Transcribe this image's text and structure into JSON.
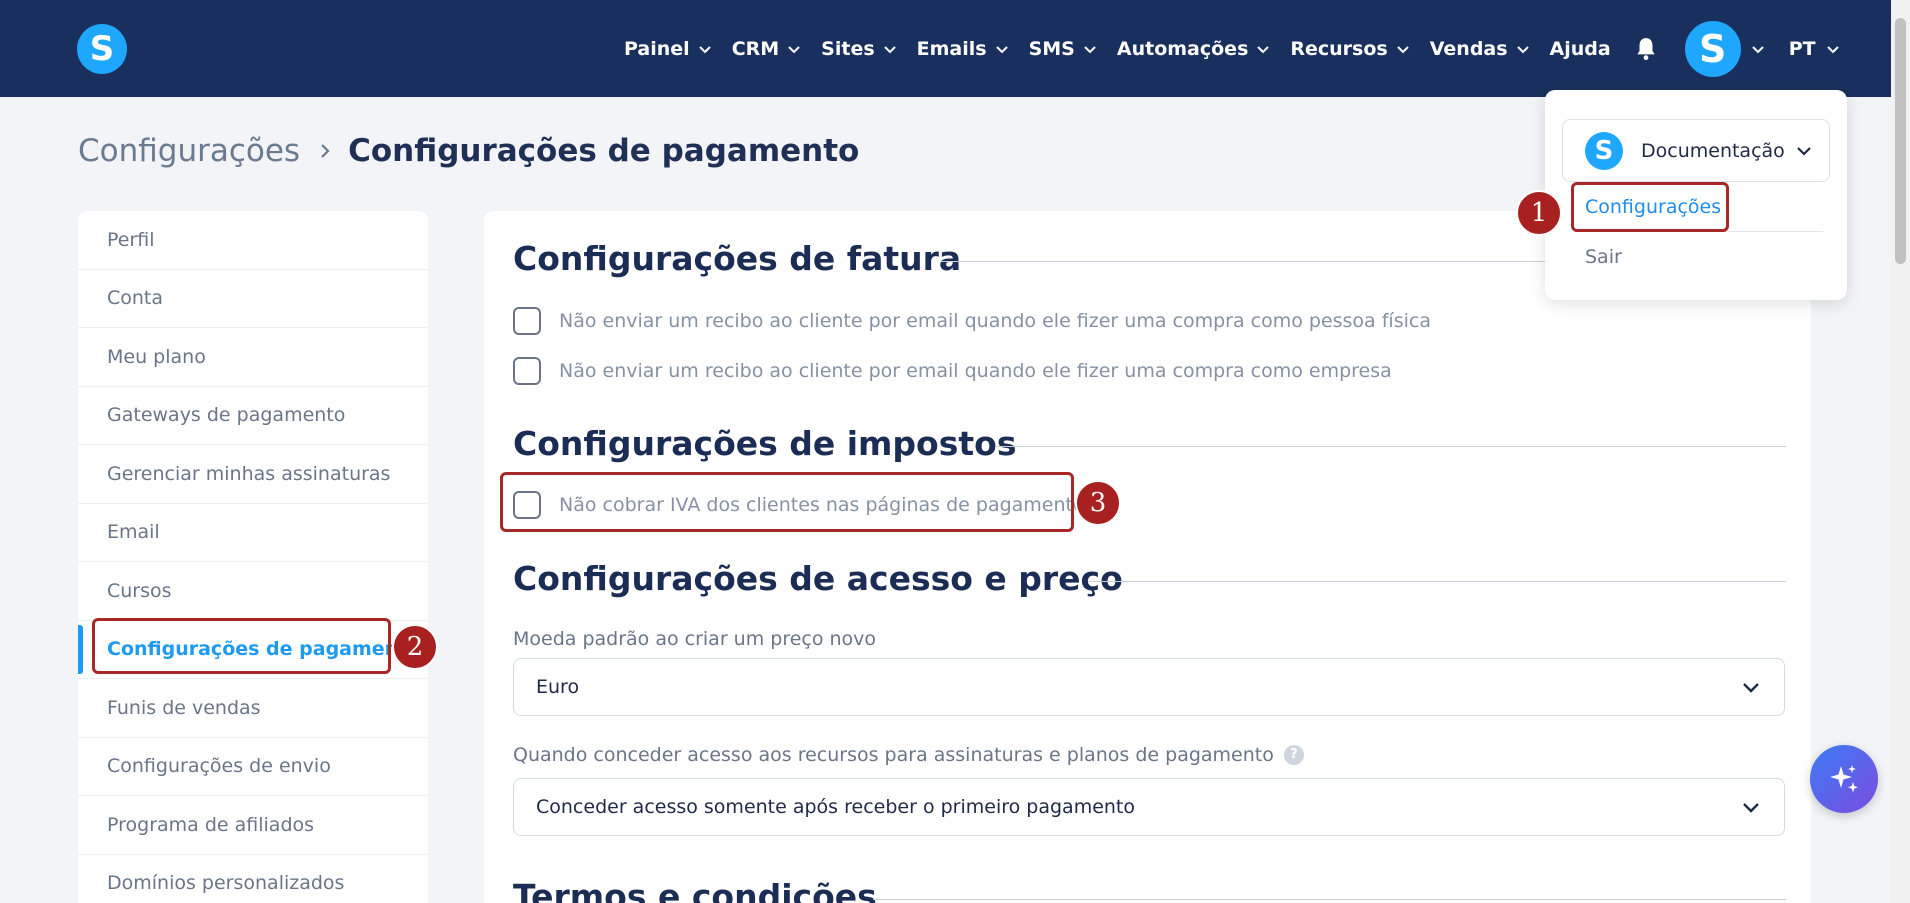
{
  "brand": {
    "logo_letter": "S"
  },
  "nav": {
    "items": [
      {
        "label": "Painel",
        "has_chevron": true
      },
      {
        "label": "CRM",
        "has_chevron": true
      },
      {
        "label": "Sites",
        "has_chevron": true
      },
      {
        "label": "Emails",
        "has_chevron": true
      },
      {
        "label": "SMS",
        "has_chevron": true
      },
      {
        "label": "Automações",
        "has_chevron": true
      },
      {
        "label": "Recursos",
        "has_chevron": true
      },
      {
        "label": "Vendas",
        "has_chevron": true
      },
      {
        "label": "Ajuda",
        "has_chevron": false
      }
    ],
    "avatar_letter": "S",
    "language": "PT"
  },
  "breadcrumb": {
    "root": "Configurações",
    "current": "Configurações de pagamento"
  },
  "sidebar": {
    "items": [
      {
        "label": "Perfil"
      },
      {
        "label": "Conta"
      },
      {
        "label": "Meu plano"
      },
      {
        "label": "Gateways de pagamento"
      },
      {
        "label": "Gerenciar minhas assinaturas"
      },
      {
        "label": "Email"
      },
      {
        "label": "Cursos"
      },
      {
        "label": "Configurações de pagamento"
      },
      {
        "label": "Funis de vendas"
      },
      {
        "label": "Configurações de envio"
      },
      {
        "label": "Programa de afiliados"
      },
      {
        "label": "Domínios personalizados"
      }
    ],
    "active_index": 7
  },
  "main": {
    "invoice": {
      "title": "Configurações de fatura",
      "options": [
        "Não enviar um recibo ao cliente por email quando ele fizer uma compra como pessoa física",
        "Não enviar um recibo ao cliente por email quando ele fizer uma compra como empresa"
      ]
    },
    "tax": {
      "title": "Configurações de impostos",
      "option": "Não cobrar IVA dos clientes nas páginas de pagamento"
    },
    "access": {
      "title": "Configurações de acesso e preço",
      "currency_label": "Moeda padrão ao criar um preço novo",
      "currency_value": "Euro",
      "access_label": "Quando conceder acesso aos recursos para assinaturas e planos de pagamento",
      "access_value": "Conceder acesso somente após receber o primeiro pagamento",
      "help_glyph": "?"
    },
    "terms": {
      "title": "Termos e condições"
    }
  },
  "dropdown": {
    "account_logo_letter": "S",
    "account_name": "Documentação",
    "config_link": "Configurações",
    "logout_link": "Sair"
  },
  "annotations": {
    "badge1": "1",
    "badge2": "2",
    "badge3": "3",
    "color": "#a8201f"
  }
}
